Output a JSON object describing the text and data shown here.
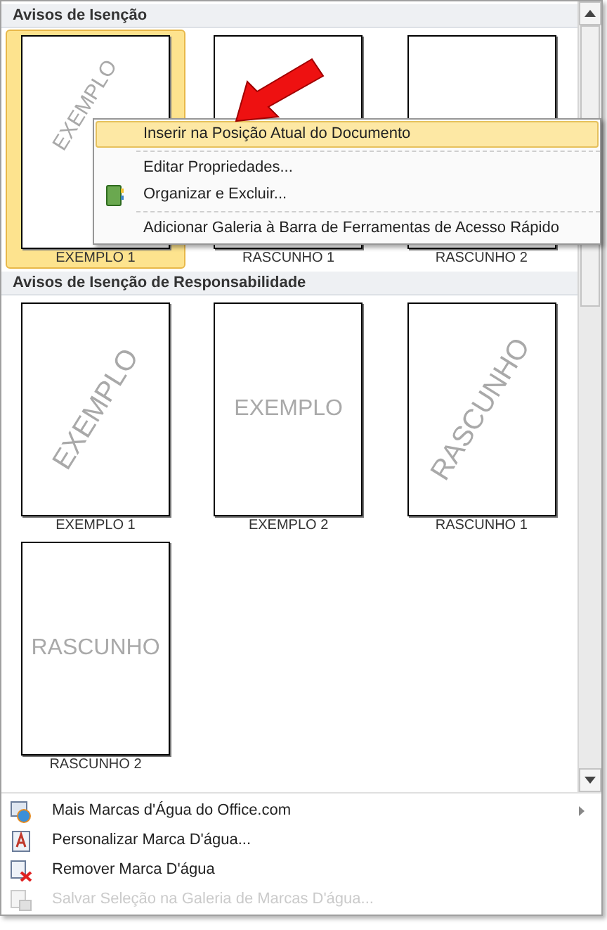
{
  "gallery": {
    "sections": [
      {
        "title": "Avisos de Isenção",
        "items": [
          {
            "label": "EXEMPLO 1",
            "watermark": "EXEMPLO",
            "kind": "diagonal",
            "selected": true
          },
          {
            "label": "RASCUNHO 1",
            "selected": false
          },
          {
            "label": "RASCUNHO 2",
            "selected": false
          }
        ]
      },
      {
        "title": "Avisos de Isenção de Responsabilidade",
        "items": [
          {
            "label": "EXEMPLO 1",
            "watermark": "EXEMPLO",
            "kind": "diagonal",
            "selected": false
          },
          {
            "label": "EXEMPLO 2",
            "watermark": "EXEMPLO",
            "kind": "horizontal",
            "selected": false
          },
          {
            "label": "RASCUNHO 1",
            "watermark": "RASCUNHO",
            "kind": "diagonal",
            "selected": false
          },
          {
            "label": "RASCUNHO 2",
            "watermark": "RASCUNHO",
            "kind": "horizontal",
            "selected": false
          }
        ]
      }
    ]
  },
  "context_menu": {
    "items": [
      {
        "label": "Inserir na Posição Atual do Documento",
        "selected": true
      },
      {
        "label": "Editar Propriedades...",
        "selected": false
      },
      {
        "label": "Organizar e Excluir...",
        "selected": false
      },
      {
        "label": "Adicionar Galeria à Barra de Ferramentas de Acesso Rápido",
        "selected": false
      }
    ]
  },
  "menu": {
    "items": [
      {
        "label": "Mais Marcas d'Água do Office.com",
        "submenu": true,
        "disabled": false
      },
      {
        "label": "Personalizar Marca D'água...",
        "submenu": false,
        "disabled": false
      },
      {
        "label": "Remover Marca D'água",
        "submenu": false,
        "disabled": false
      },
      {
        "label": "Salvar Seleção na Galeria de Marcas D'água...",
        "submenu": false,
        "disabled": true
      }
    ]
  }
}
